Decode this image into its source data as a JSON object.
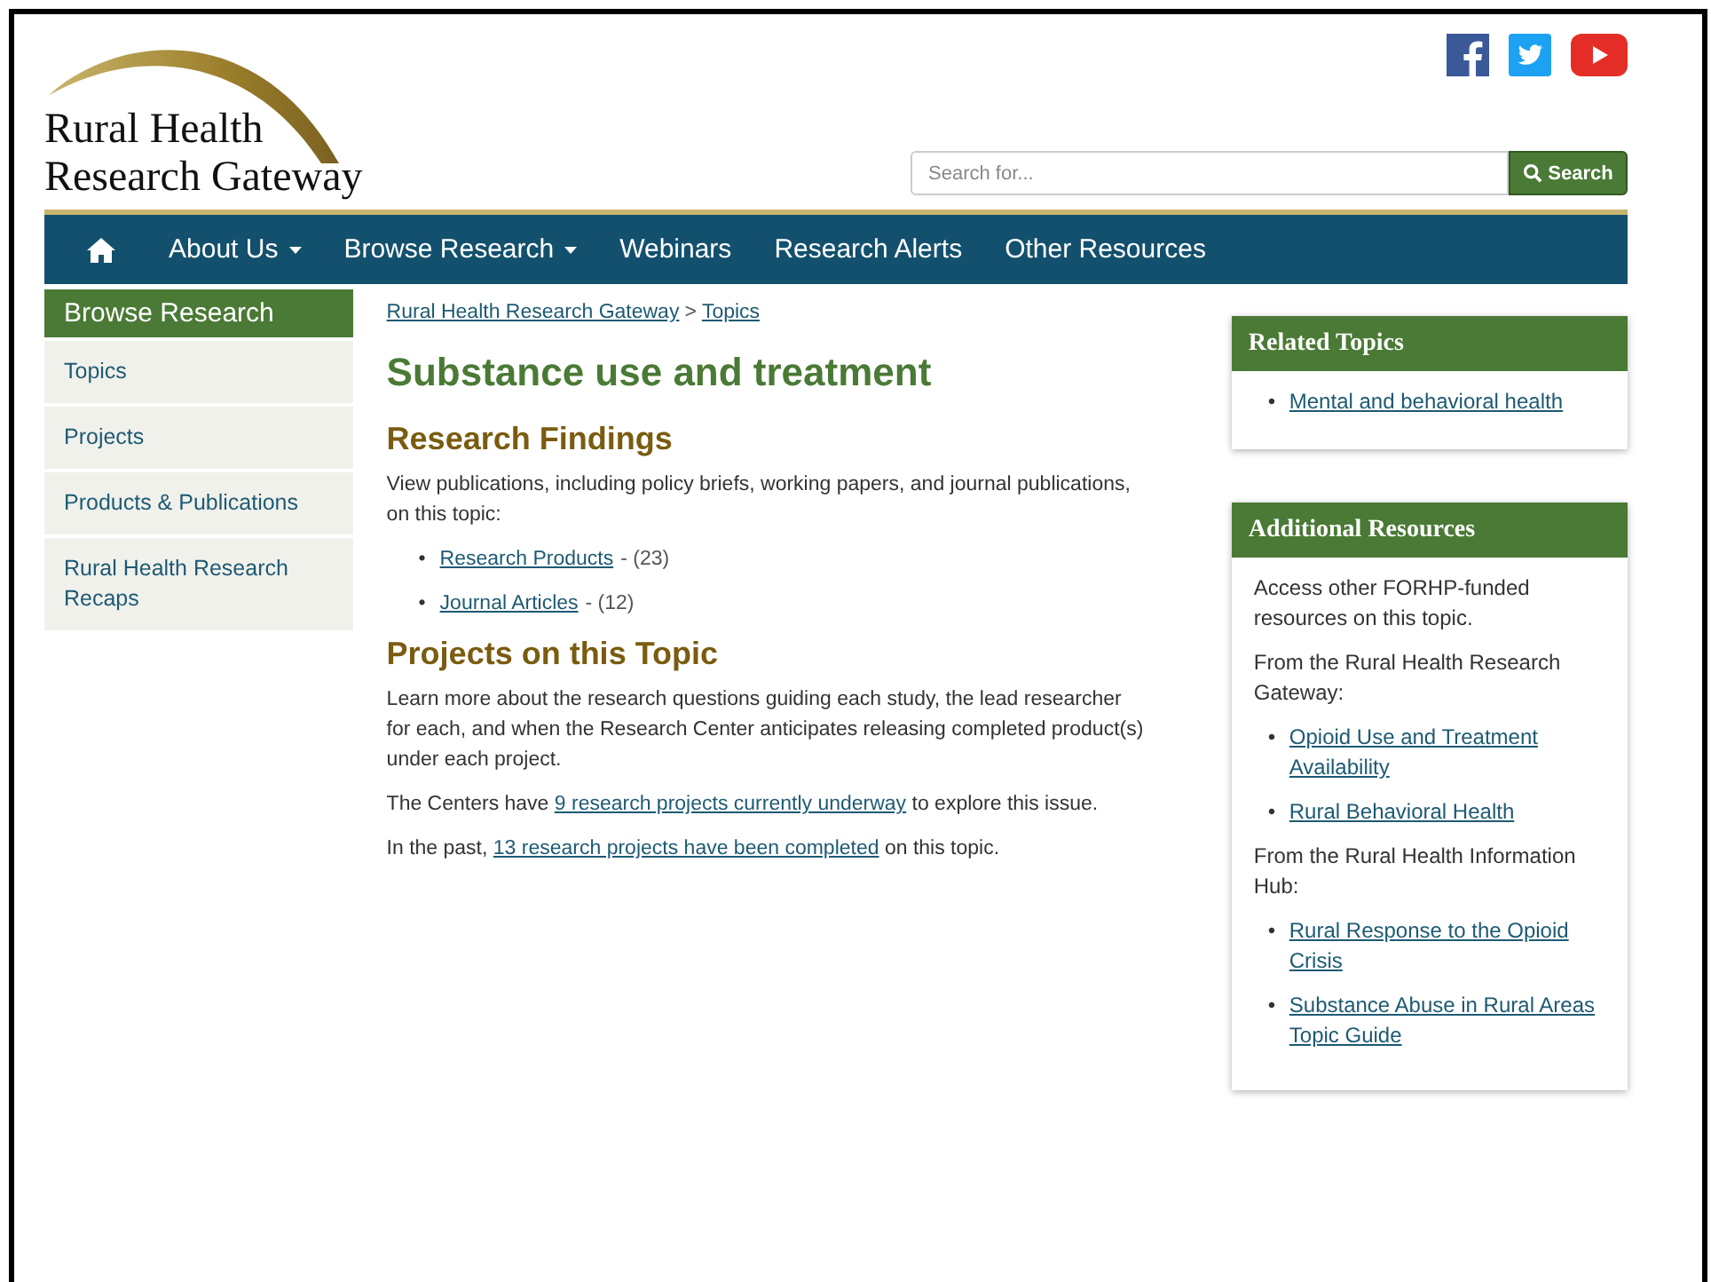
{
  "logo": {
    "line1": "Rural Health",
    "line2": "Research Gateway"
  },
  "search": {
    "placeholder": "Search for...",
    "button": "Search"
  },
  "nav": [
    {
      "label": "About Us",
      "dropdown": true
    },
    {
      "label": "Browse Research",
      "dropdown": true
    },
    {
      "label": "Webinars",
      "dropdown": false
    },
    {
      "label": "Research Alerts",
      "dropdown": false
    },
    {
      "label": "Other Resources",
      "dropdown": false
    }
  ],
  "sidebar": {
    "title": "Browse Research",
    "items": [
      "Topics",
      "Projects",
      "Products & Publications",
      "Rural Health Research Recaps"
    ]
  },
  "breadcrumb": {
    "items": [
      "Rural Health Research Gateway",
      "Topics"
    ],
    "separator": ">"
  },
  "page_title": "Substance use and treatment",
  "findings": {
    "heading": "Research Findings",
    "text": "View publications, including policy briefs, working papers, and journal publications, on this topic:",
    "links": [
      {
        "marker": "•",
        "label": "Research Products",
        "count": "- (23)"
      },
      {
        "marker": "•",
        "label": "Journal Articles",
        "count": "- (12)"
      }
    ]
  },
  "projects": {
    "heading": "Projects on this Topic",
    "text": "Learn more about the research questions guiding each study, the lead researcher for each, and when the Research Center anticipates releasing completed product(s) under each project.",
    "sentences": [
      {
        "before": "The Centers have ",
        "link": "9 research projects currently underway",
        "after": " to explore this issue."
      },
      {
        "before": "In the past, ",
        "link": "13 research projects have been completed",
        "after": " on this topic."
      }
    ]
  },
  "related_topics": {
    "title": "Related Topics",
    "links": [
      {
        "marker": "•",
        "label": "Mental and behavioral health"
      }
    ]
  },
  "additional_resources": {
    "title": "Additional Resources",
    "blocks": [
      {
        "kind": "text",
        "text": "Access other FORHP-funded resources on this topic."
      },
      {
        "kind": "text",
        "text": "From the Rural Health Research Gateway:"
      },
      {
        "kind": "links",
        "links": [
          {
            "marker": "•",
            "label": "Opioid Use and Treatment Availability"
          },
          {
            "marker": "•",
            "label": "Rural Behavioral Health"
          }
        ]
      },
      {
        "kind": "text",
        "text": "From the Rural Health Information Hub:"
      },
      {
        "kind": "links",
        "links": [
          {
            "marker": "•",
            "label": "Rural Response to the Opioid Crisis"
          },
          {
            "marker": "•",
            "label": "Substance Abuse in Rural Areas Topic Guide"
          }
        ]
      }
    ]
  }
}
